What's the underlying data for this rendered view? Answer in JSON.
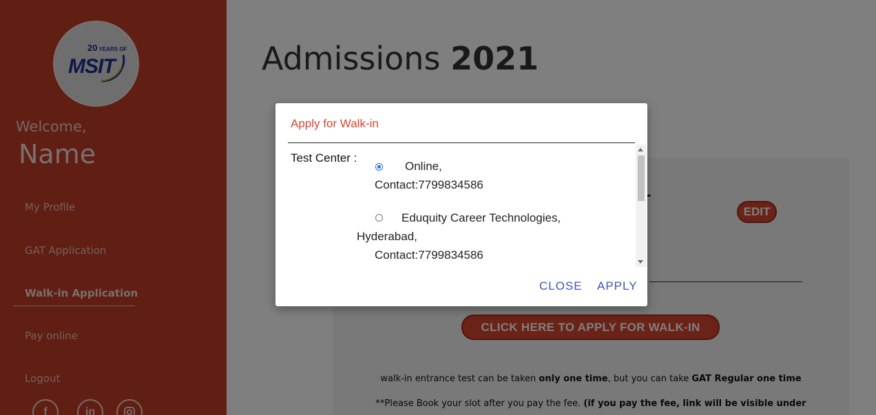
{
  "sidebar": {
    "logo": {
      "years_number": "20",
      "years_text": "YEARS OF",
      "brand": "MSIT"
    },
    "welcome": "Welcome,",
    "user_name": "Name",
    "nav": [
      {
        "label": "My Profile"
      },
      {
        "label": "GAT Application"
      },
      {
        "label": "Walk-in Application"
      },
      {
        "label": "Pay online"
      },
      {
        "label": "Logout"
      }
    ],
    "social": [
      "facebook-icon",
      "linkedin-icon",
      "instagram-icon"
    ]
  },
  "main": {
    "title_prefix": "Admissions",
    "title_year": "2021",
    "card_heading_fragment": "r",
    "edit_label": "EDIT",
    "apply_walkin_label": "CLICK HERE TO APPLY FOR WALK-IN",
    "note1": {
      "a": "walk-in entrance test can be taken ",
      "b": "only one time",
      "c": ", but you can take ",
      "d": "GAT Regular one time"
    },
    "note2": {
      "a": "**Please Book your slot after you pay the fee. ",
      "b": "(if you pay the fee, link will be visible under"
    }
  },
  "modal": {
    "title": "Apply for Walk-in",
    "test_center_label": "Test Center :",
    "options": [
      {
        "line1": "Online,",
        "contact": "Contact:7799834586",
        "selected": true
      },
      {
        "line1": "Eduquity Career Technologies,",
        "line2": "Hyderabad,",
        "contact": "Contact:7799834586",
        "selected": false
      }
    ],
    "close_label": "CLOSE",
    "apply_label": "APPLY"
  },
  "colors": {
    "sidebar": "#c33d26",
    "accent_red": "#d6452f",
    "modal_title": "#d8452e",
    "action_blue": "#3f51b5",
    "radio_blue": "#1a73e8"
  }
}
